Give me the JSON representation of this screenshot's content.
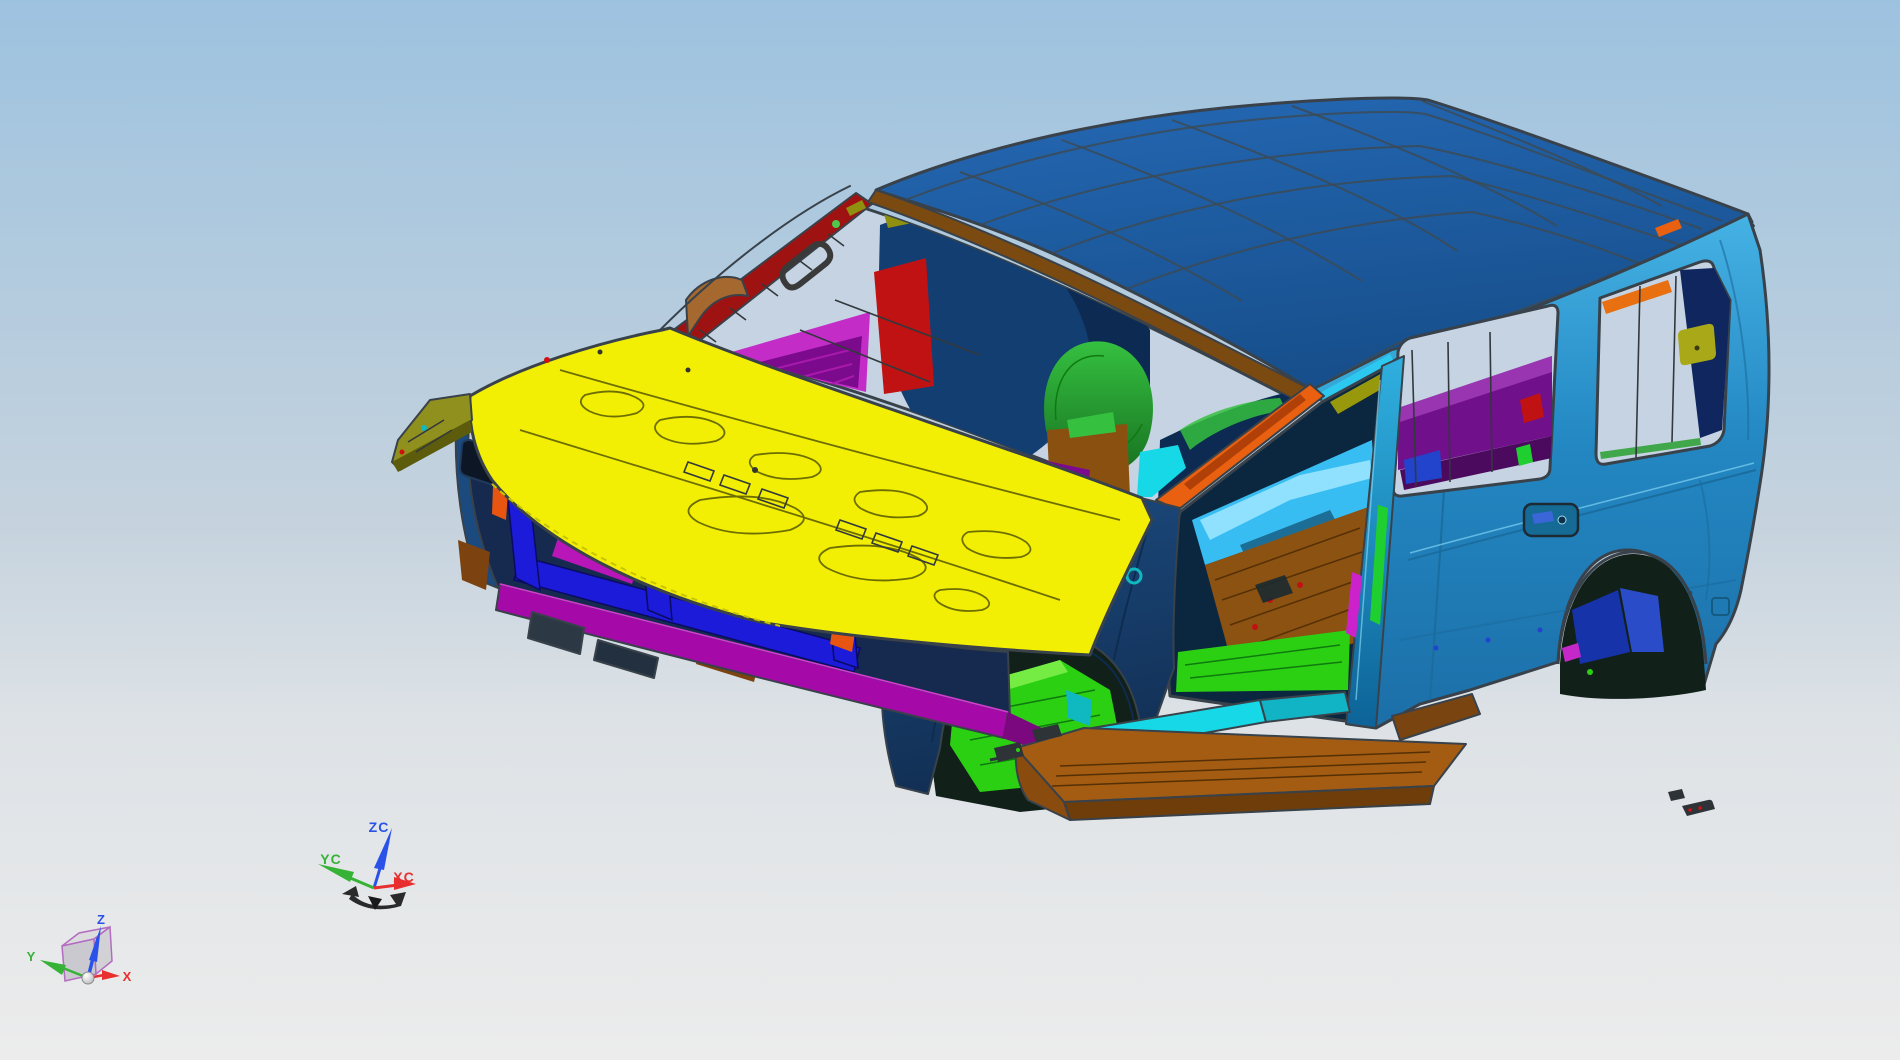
{
  "viewport": {
    "description": "3D CAD graphics viewport showing a vehicle body-in-white assembly in shaded view"
  },
  "axes": {
    "wcs": {
      "z_label": "ZC",
      "y_label": "YC",
      "x_label": "XC"
    },
    "view_triad": {
      "z_label": "Z",
      "y_label": "Y",
      "x_label": "X"
    }
  },
  "palette": {
    "bgTop": "#9dc2df",
    "bgMid1": "#c6d3de",
    "bgMid2": "#dde2e6",
    "bgBot": "#ececec",
    "roofTop": "#2468b4",
    "roofBot": "#174f8c",
    "headerBrown": "#7b4a10",
    "railBlue": "#35a8d8",
    "railCyan": "#2cc8f0",
    "railRed": "#cf1515",
    "railOrange": "#e86010",
    "aPillarRed": "#9e1212",
    "aPillarBrown": "#a5682e",
    "skyThrough": "#c5d3e2",
    "dashNavy": "#133e71",
    "dashNavyDk": "#0d2b52",
    "intRed": "#c01212",
    "intOlive": "#8f8f10",
    "intBrown": "#8a5010",
    "whGreenHi": "#35c040",
    "whGreenLo": "#177020",
    "cowlMagenta": "#c42cc8",
    "cowlPurple": "#7c0a8c",
    "hoodYellow": "#f2ef04",
    "hoodDotted": "#c8c400",
    "fenderHi": "#1b4a7e",
    "fenderLo": "#122f54",
    "floorCyan": "#38bdf2",
    "floorCyanHi": "#9fe8ff",
    "tunnelBrown": "#8c5212",
    "floorGreen": "#2bd012",
    "floorGreenHi": "#7dee4a",
    "doorShadow": "#0b2740",
    "oliveSliver": "#98980c",
    "pillarBHi": "#2fb0e0",
    "pillarBLo": "#0d6398",
    "sliverGreen": "#1fcf30",
    "sliverMagenta": "#cc22cc",
    "bodyHi": "#45b2e4",
    "bodyMid": "#2387c2",
    "bodyLo": "#1c6fa8",
    "qwinPurple": "#70108a",
    "qwinPurpleHi": "#9a35b2",
    "qwinCyan": "#30c0e8",
    "qwinNavy": "#10265e",
    "qwinOrange": "#e87010",
    "qwinOlive": "#a8a818",
    "qwinBlue": "#2244cc",
    "archDark": "#12201a",
    "whouseBlue1": "#1733aa",
    "whouseBlue2": "#2a4cc8",
    "whouseMagenta": "#c428c8",
    "frontBase": "#152a4e",
    "frontBlue": "#1b1bd9",
    "slatBlue": "#2222e8",
    "slatBg": "#0a0a30",
    "grMagenta": "#b816b8",
    "grPink": "#e060d8",
    "grGreen": "#1fb818",
    "grOrange": "#e85510",
    "grTeal": "#10b8c0",
    "grOlive": "#8a8a12",
    "grBrown": "#7c4210",
    "grRed": "#a81010",
    "bumperMagenta": "#a50aa8",
    "bumperMagentaDk": "#7c0880",
    "underDark": "#2c3844",
    "apronOlive": "#90901e",
    "apronOliveDk": "#5c5c0c",
    "sillCyan": "#16d8e6",
    "sillTeal": "#10b4c4",
    "boardTop": "#a35c12",
    "boardSide": "#6e3d0a",
    "boardCap": "#8a4c0e",
    "partDark": "#2e3338",
    "headlamp": "#0c1624",
    "axisBlue": "#2a52e8",
    "axisGreen": "#36b336",
    "axisRed": "#e82e2e",
    "cubeEdge": "#b36cc0",
    "cubeFace1": "#dcdcdf",
    "cubeFace2": "#c9c9cf",
    "cubeFace3": "#d2d2d6",
    "sphereHi": "#ffffff",
    "sphereLo": "#b0b0b6",
    "specRed": "#d01010"
  }
}
